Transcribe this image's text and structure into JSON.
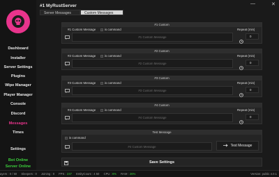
{
  "app": {
    "title": "#1 MyRustServer"
  },
  "window": {
    "minimize": "—",
    "close": "✕"
  },
  "tabs": [
    {
      "label": "Server Messages",
      "active": false
    },
    {
      "label": "Custom Messages",
      "active": true
    }
  ],
  "sidebar": {
    "items": [
      {
        "label": "Dashboard"
      },
      {
        "label": "Installer"
      },
      {
        "label": "Server Settings"
      },
      {
        "label": "Plugins"
      },
      {
        "label": "Wipe Manager"
      },
      {
        "label": "Player Manager"
      },
      {
        "label": "Console"
      },
      {
        "label": "Discord"
      },
      {
        "label": "Messages",
        "active": true
      },
      {
        "label": "Times"
      }
    ],
    "settings": "Settings",
    "bot_status": "Bot Online",
    "server_status": "Server Online"
  },
  "custom_panels": [
    {
      "header": "#1 Custom",
      "label": "#1 Custom Message",
      "command_label": "is command",
      "placeholder": "#1 Custom Message",
      "repeat_label": "Repeat (min)",
      "repeat_value": "0"
    },
    {
      "header": "#2 Custom",
      "label": "#2 Custom Message",
      "command_label": "is command",
      "placeholder": "#2 Custom Message",
      "repeat_label": "Repeat (min)",
      "repeat_value": "0"
    },
    {
      "header": "#3 Custom",
      "label": "#3 Custom Message",
      "command_label": "is command",
      "placeholder": "#3 Custom Message",
      "repeat_label": "Repeat (min)",
      "repeat_value": "0"
    },
    {
      "header": "#4 Custom",
      "label": "#4 Custom Message",
      "command_label": "is command",
      "placeholder": "#4 Custom Message",
      "repeat_label": "Repeat (min)",
      "repeat_value": "0"
    }
  ],
  "test_panel": {
    "header": "Test Message",
    "command_label": "is command",
    "placeholder": "#4 Custom Message",
    "button_label": "Test Message"
  },
  "save_button": "Save Settings",
  "statusbar": {
    "items": [
      {
        "label": "ayers :",
        "value": "0 / 50"
      },
      {
        "label": "Sleepers :",
        "value": "0"
      },
      {
        "label": "Joining :",
        "value": "0"
      },
      {
        "label": "FPS :",
        "value": "237"
      },
      {
        "label": "EntityCount :",
        "value": "4 50"
      },
      {
        "label": "CPU :",
        "value": "6%"
      },
      {
        "label": "RAM :",
        "value": "26%"
      }
    ],
    "version": "Version: public 4.0.1"
  },
  "colors": {
    "accent": "#e8348c",
    "online": "#3cd03c",
    "background": "#1a1a1a"
  }
}
